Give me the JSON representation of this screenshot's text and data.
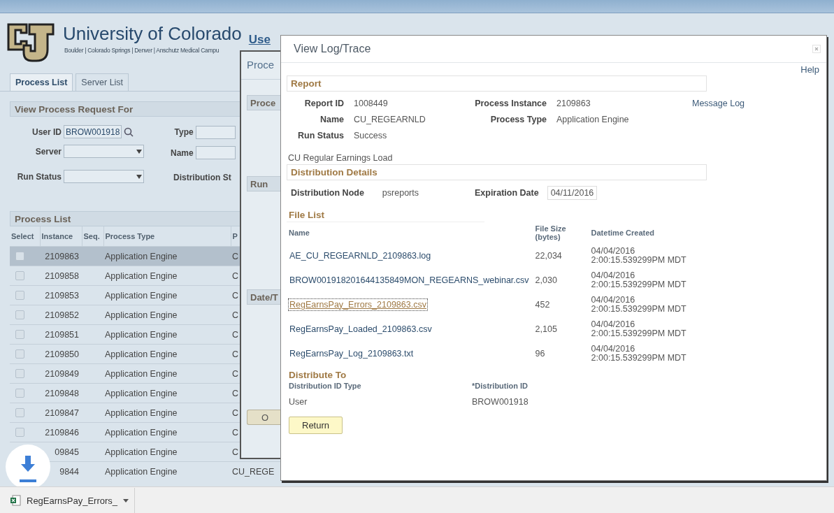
{
  "header": {
    "title": "University of Colorado",
    "subtitle": "Boulder | Colorado Springs | Denver | Anschutz Medical Campu",
    "page_title": "Use"
  },
  "tabs": [
    {
      "label": "Process List",
      "selected": true
    },
    {
      "label": "Server List",
      "selected": false
    }
  ],
  "request_panel": {
    "title": "View Process Request For",
    "left_fields": [
      {
        "kind": "search",
        "label": "User ID",
        "value": "BROW001918"
      },
      {
        "kind": "select",
        "label": "Server"
      },
      {
        "kind": "select",
        "label": "Run Status"
      }
    ],
    "right_fields": [
      {
        "kind": "text",
        "label": "Type"
      },
      {
        "kind": "text",
        "label": "Name"
      },
      {
        "kind": "label",
        "label": "Distribution St"
      }
    ]
  },
  "process_list": {
    "title": "Process List",
    "columns": [
      "Select",
      "Instance",
      "Seq.",
      "Process Type",
      "P"
    ],
    "rows": [
      {
        "selected": true,
        "checked": false,
        "instance": "2109863",
        "process_type": "Application Engine",
        "column_5": "C"
      },
      {
        "selected": false,
        "checked": false,
        "instance": "2109858",
        "process_type": "Application Engine",
        "column_5": "C"
      },
      {
        "selected": false,
        "checked": false,
        "instance": "2109853",
        "process_type": "Application Engine",
        "column_5": "C"
      },
      {
        "selected": false,
        "checked": false,
        "instance": "2109852",
        "process_type": "Application Engine",
        "column_5": "C"
      },
      {
        "selected": false,
        "checked": false,
        "instance": "2109851",
        "process_type": "Application Engine",
        "column_5": "C"
      },
      {
        "selected": false,
        "checked": false,
        "instance": "2109850",
        "process_type": "Application Engine",
        "column_5": "C"
      },
      {
        "selected": false,
        "checked": false,
        "instance": "2109849",
        "process_type": "Application Engine",
        "column_5": "C"
      },
      {
        "selected": false,
        "checked": false,
        "instance": "2109848",
        "process_type": "Application Engine",
        "column_5": "C"
      },
      {
        "selected": false,
        "checked": false,
        "instance": "2109847",
        "process_type": "Application Engine",
        "column_5": "C"
      },
      {
        "selected": false,
        "checked": false,
        "instance": "2109846",
        "process_type": "Application Engine",
        "column_5": "C"
      },
      {
        "selected": false,
        "instance": "09845",
        "process_type": "Application Engine",
        "column_5": "C"
      },
      {
        "selected": false,
        "instance": "9844",
        "process_type": "Application Engine",
        "column_5": "CU_REGE"
      }
    ]
  },
  "detail_dialog": {
    "title": "Proce",
    "sections": [
      "Proce",
      "Run",
      "Date/T"
    ],
    "button": "O"
  },
  "log_dialog": {
    "title": "View Log/Trace",
    "help": "Help",
    "report": {
      "heading": "Report",
      "report_id_label": "Report ID",
      "report_id": "1008449",
      "instance_label": "Process Instance",
      "instance": "2109863",
      "message_log": "Message Log",
      "name_label": "Name",
      "name": "CU_REGEARNLD",
      "type_label": "Process Type",
      "type": "Application Engine",
      "status_label": "Run Status",
      "status": "Success",
      "description": "CU Regular Earnings Load"
    },
    "distribution": {
      "heading": "Distribution Details",
      "node_label": "Distribution Node",
      "node": "psreports",
      "expiration_label": "Expiration Date",
      "expiration": "04/11/2016"
    },
    "file_list": {
      "heading": "File List",
      "columns": [
        "Name",
        "File Size (bytes)",
        "Datetime Created"
      ],
      "rows": [
        {
          "name": "AE_CU_REGEARNLD_2109863.log",
          "size": "22,034",
          "created": "04/04/2016 2:00:15.539299PM MDT",
          "focused": false
        },
        {
          "name": "BROW001918201644135849MON_REGEARNS_webinar.csv",
          "size": "2,030",
          "created": "04/04/2016 2:00:15.539299PM MDT",
          "focused": false
        },
        {
          "name": "RegEarnsPay_Errors_2109863.csv",
          "size": "452",
          "created": "04/04/2016 2:00:15.539299PM MDT",
          "focused": true
        },
        {
          "name": "RegEarnsPay_Loaded_2109863.csv",
          "size": "2,105",
          "created": "04/04/2016 2:00:15.539299PM MDT",
          "focused": false
        },
        {
          "name": "RegEarnsPay_Log_2109863.txt",
          "size": "96",
          "created": "04/04/2016 2:00:15.539299PM MDT",
          "focused": false
        }
      ]
    },
    "distribute_to": {
      "heading": "Distribute To",
      "columns": [
        "Distribution ID Type",
        "*Distribution ID"
      ],
      "row": [
        "User",
        "BROW001918"
      ]
    },
    "return_button": "Return"
  },
  "download_shelf": {
    "file": "RegEarnsPay_Errors_"
  }
}
